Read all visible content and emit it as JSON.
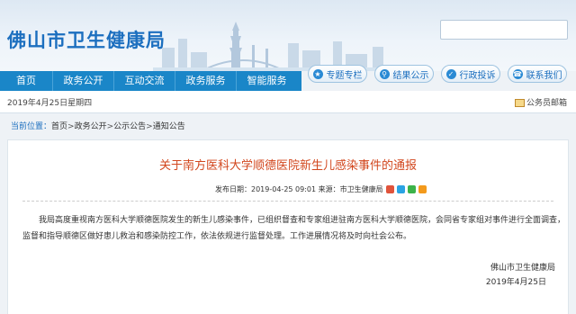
{
  "site": {
    "title": "佛山市卫生健康局"
  },
  "search": {
    "placeholder": ""
  },
  "nav": [
    {
      "label": "首页"
    },
    {
      "label": "政务公开"
    },
    {
      "label": "互动交流"
    },
    {
      "label": "政务服务"
    },
    {
      "label": "智能服务"
    }
  ],
  "quick_links": [
    {
      "label": "专题专栏",
      "icon": "star-icon"
    },
    {
      "label": "结果公示",
      "icon": "search-icon"
    },
    {
      "label": "行政投诉",
      "icon": "shield-icon"
    },
    {
      "label": "联系我们",
      "icon": "phone-icon"
    }
  ],
  "topbar": {
    "date": "2019年4月25日星期四",
    "mail_label": "公务员邮箱"
  },
  "breadcrumb": {
    "label": "当前位置：",
    "items": [
      "首页",
      "政务公开",
      "公示公告",
      "通知公告"
    ],
    "sep": ">"
  },
  "article": {
    "title": "关于南方医科大学顺德医院新生儿感染事件的通报",
    "date_label": "发布日期：",
    "date": "2019-04-25 09:01",
    "source_label": "来源：",
    "source": "市卫生健康局",
    "share_colors": [
      "#e0533b",
      "#2aa3e3",
      "#3cb34a",
      "#f39a1c"
    ],
    "body": "我局高度重视南方医科大学顺德医院发生的新生儿感染事件，已组织督查和专家组进驻南方医科大学顺德医院，会同省专家组对事件进行全面调查，监督和指导顺德区做好患儿救治和感染防控工作，依法依规进行监督处理。工作进展情况将及时向社会公布。",
    "signature": "佛山市卫生健康局",
    "sign_date": "2019年4月25日"
  },
  "colors": {
    "brand": "#1c6fbf",
    "nav": "#1a86c8",
    "title": "#d2471e"
  }
}
